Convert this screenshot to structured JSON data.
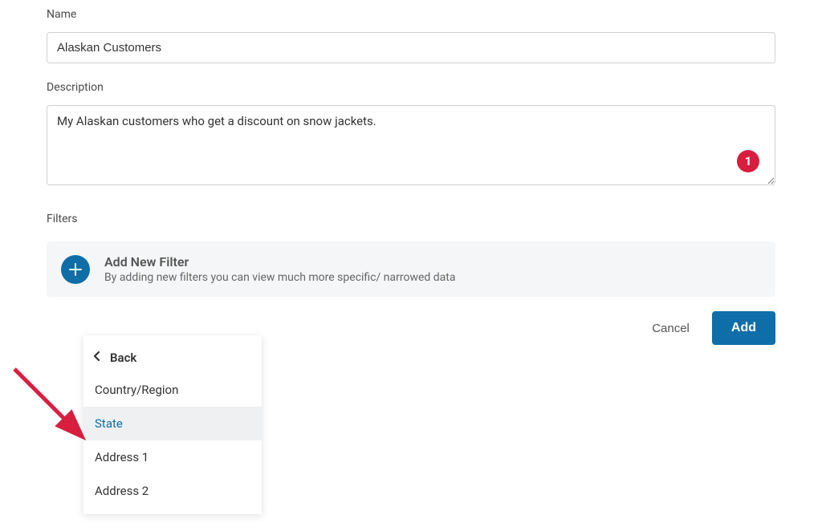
{
  "form": {
    "name_label": "Name",
    "name_value": "Alaskan Customers",
    "description_label": "Description",
    "description_value": "My Alaskan customers who get a discount on snow jackets."
  },
  "badge": {
    "number": "1"
  },
  "filters": {
    "section_label": "Filters",
    "add_panel": {
      "title": "Add New Filter",
      "subtitle": "By adding new filters you can view much more specific/ narrowed data"
    }
  },
  "actions": {
    "cancel": "Cancel",
    "add": "Add"
  },
  "dropdown": {
    "back_label": "Back",
    "items": [
      {
        "label": "Country/Region",
        "hover": false
      },
      {
        "label": "State",
        "hover": true
      },
      {
        "label": "Address 1",
        "hover": false
      },
      {
        "label": "Address 2",
        "hover": false
      }
    ]
  }
}
